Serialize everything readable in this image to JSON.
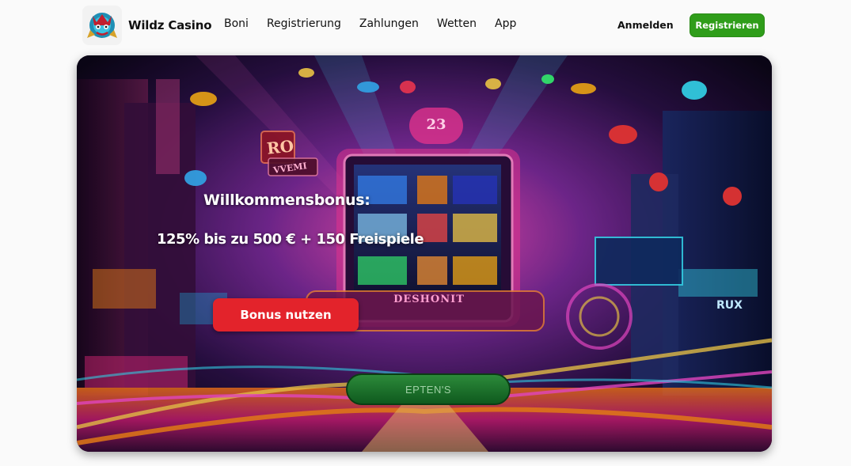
{
  "header": {
    "brand": "Wildz Casino",
    "nav": [
      {
        "label": "Boni"
      },
      {
        "label": "Registrierung"
      },
      {
        "label": "Zahlungen"
      },
      {
        "label": "Wetten"
      },
      {
        "label": "App"
      }
    ],
    "login_label": "Anmelden",
    "register_label": "Registrieren",
    "register_color": "#2f9d1a"
  },
  "hero": {
    "title": "Willkommensbonus:",
    "offer": "125% bis zu 500 € + 150 Freispiele",
    "cta_label": "Bonus nutzen",
    "cta_color": "#e3232b",
    "scene_texts": {
      "machine_number": "23",
      "machine_brand": "DESHONIT",
      "sign_button": "EPTEN'S",
      "sign_ro": "RO",
      "sign_vvemi": "VVEMI",
      "sign_rux": "RUX"
    }
  }
}
